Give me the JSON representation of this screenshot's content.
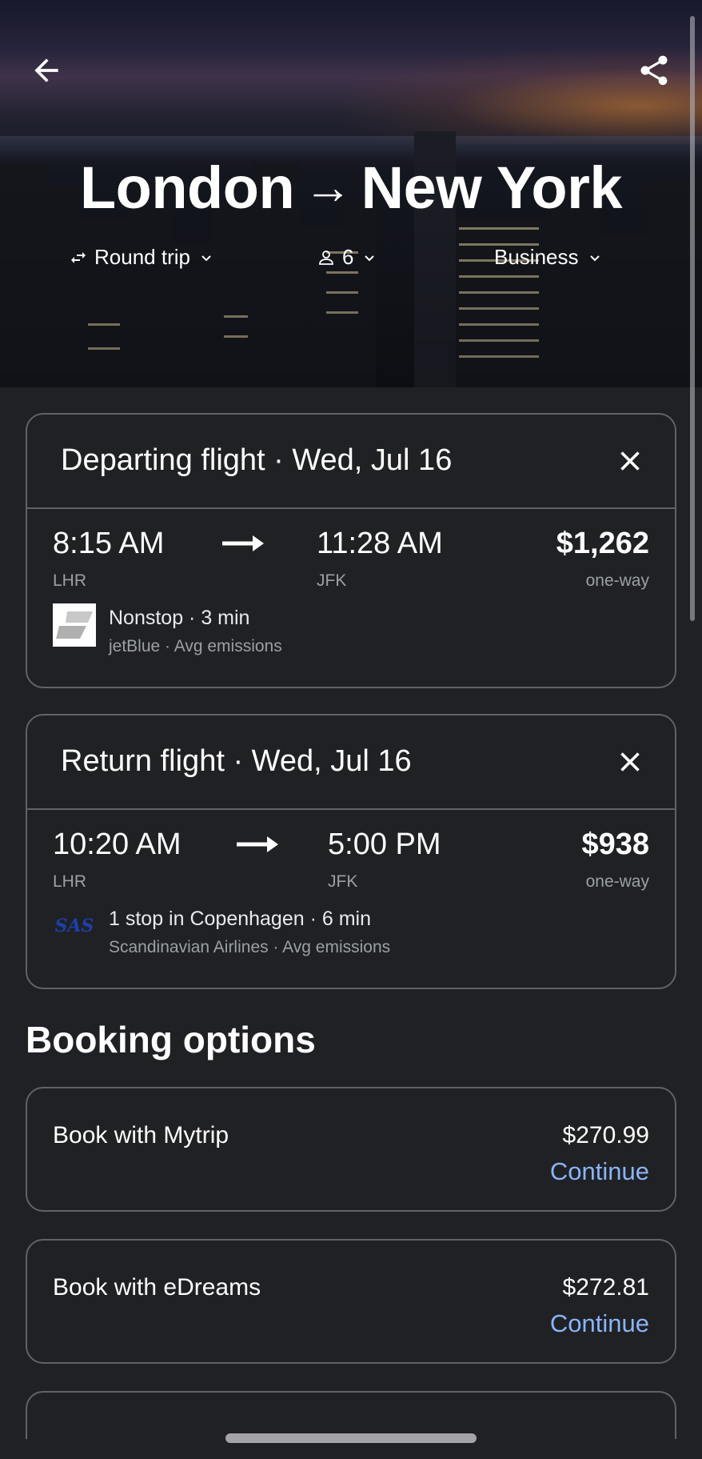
{
  "header": {
    "origin": "London",
    "route_arrow": "→",
    "destination": "New York",
    "back_icon": "arrow-left-icon",
    "share_icon": "share-icon"
  },
  "trip_options": {
    "trip_type": "Round trip",
    "passengers": "6",
    "cabin_class": "Business"
  },
  "departing": {
    "title": "Departing flight · Wed, Jul 16",
    "depart_time": "8:15 AM",
    "arrive_time": "11:28 AM",
    "depart_airport": "LHR",
    "arrive_airport": "JFK",
    "price": "$1,262",
    "price_note": "one-way",
    "stops": "Nonstop · 3 min",
    "airline_meta": "jetBlue · Avg emissions",
    "airline_logo": "jetblue-logo"
  },
  "return": {
    "title": "Return flight · Wed, Jul 16",
    "depart_time": "10:20 AM",
    "arrive_time": "5:00 PM",
    "depart_airport": "LHR",
    "arrive_airport": "JFK",
    "price": "$938",
    "price_note": "one-way",
    "stops": "1 stop in Copenhagen · 6 min",
    "airline_meta": "Scandinavian Airlines · Avg emissions",
    "airline_logo_text": "SAS"
  },
  "booking": {
    "section_title": "Booking options",
    "options": [
      {
        "label": "Book with Mytrip",
        "price": "$270.99",
        "action": "Continue"
      },
      {
        "label": "Book with eDreams",
        "price": "$272.81",
        "action": "Continue"
      }
    ]
  },
  "colors": {
    "background": "#202124",
    "border": "#5f6368",
    "link": "#8ab4f8",
    "muted_text": "#9aa0a6"
  }
}
